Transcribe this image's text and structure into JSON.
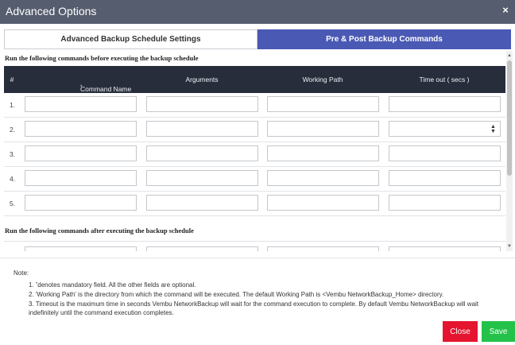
{
  "window": {
    "title": "Advanced Options",
    "close_glyph": "×"
  },
  "tabs": [
    {
      "label": "Advanced Backup Schedule Settings",
      "active": false
    },
    {
      "label": "Pre & Post Backup Commands",
      "active": true
    }
  ],
  "pre_section": {
    "heading": "Run the following commands before executing the backup schedule"
  },
  "post_section": {
    "heading": "Run the following commands after executing the backup schedule"
  },
  "table": {
    "headers": {
      "num": "#",
      "command": "Command Name",
      "command_star": "*",
      "arguments": "Arguments",
      "working_path": "Working Path",
      "timeout": "Time out ( secs )"
    },
    "rows": [
      {
        "num": "1.",
        "command": "",
        "arguments": "",
        "working_path": "",
        "timeout": ""
      },
      {
        "num": "2.",
        "command": "",
        "arguments": "",
        "working_path": "",
        "timeout": ""
      },
      {
        "num": "3.",
        "command": "",
        "arguments": "",
        "working_path": "",
        "timeout": ""
      },
      {
        "num": "4.",
        "command": "",
        "arguments": "",
        "working_path": "",
        "timeout": ""
      },
      {
        "num": "5.",
        "command": "",
        "arguments": "",
        "working_path": "",
        "timeout": ""
      }
    ]
  },
  "notes": {
    "title": "Note:",
    "items": [
      {
        "prefix": "1. ",
        "star": "*",
        "text": "denotes mandatory field. All the other fields are optional."
      },
      {
        "prefix": "",
        "star": "",
        "text": "2. 'Working Path' is the directory from which the command will be executed. The default Working Path is <Vembu NetworkBackup_Home> directory."
      },
      {
        "prefix": "",
        "star": "",
        "text": "3. Timeout is the maximum time in seconds Vembu NetworkBackup will wait for the command execution to complete. By default Vembu NetworkBackup will wait indefinitely until the command execution completes."
      }
    ]
  },
  "buttons": {
    "close": "Close",
    "save": "Save"
  },
  "colors": {
    "titlebar": "#565d6e",
    "active_tab": "#4a59b4",
    "table_header": "#272d3b",
    "close_button": "#e5142f",
    "save_button": "#24c24a"
  },
  "icons": {
    "close": "close-icon",
    "spinner": "number-spinner-icon",
    "scroll_up": "scroll-up-icon",
    "scroll_down": "scroll-down-icon"
  }
}
